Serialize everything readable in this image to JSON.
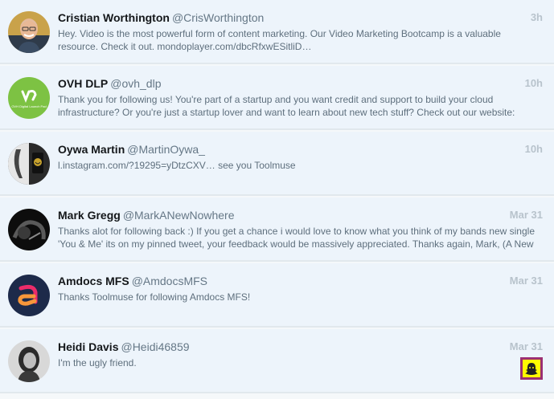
{
  "notifications": [
    {
      "name": "Cristian Worthington",
      "handle": "@CrisWorthington",
      "time": "3h",
      "text": "Hey. Video is the most powerful form of content marketing. Our Video Marketing Bootcamp is a valuable\nresource. Check it out. mondoplayer.com/dbcRfxwESitliD…",
      "avatar_icon": "avatar-man-photo"
    },
    {
      "name": "OVH DLP",
      "handle": "@ovh_dlp",
      "time": "10h",
      "text": "Thank you for following us! You're part of a startup and you want credit and support to build your cloud\ninfrastructure? Or you're just a startup lover and want to learn about new tech stuff? Check out our website:",
      "avatar_icon": "ovh-logo",
      "avatar_caption": "OVH Digital Launch Pad"
    },
    {
      "name": "Oywa Martin",
      "handle": "@MartinOywa_",
      "time": "10h",
      "text": "l.instagram.com/?19295=yDtzCXV… see you Toolmuse",
      "avatar_icon": "avatar-photo"
    },
    {
      "name": "Mark Gregg",
      "handle": "@MarkANewNowhere",
      "time": "Mar 31",
      "text": "Thanks alot for following back :) If you get a chance i would love to know what you think of my bands new single\n'You & Me' its on my pinned tweet, your feedback would be massively appreciated. Thanks again, Mark, (A New",
      "avatar_icon": "avatar-dark-photo"
    },
    {
      "name": "Amdocs MFS",
      "handle": "@AmdocsMFS",
      "time": "Mar 31",
      "text": "Thanks Toolmuse for following Amdocs MFS!",
      "avatar_icon": "amdocs-logo"
    },
    {
      "name": "Heidi Davis",
      "handle": "@Heidi46859",
      "time": "Mar 31",
      "text": "I'm the ugly friend.",
      "avatar_icon": "avatar-woman-photo",
      "media_icon": "snapchat-thumbnail"
    }
  ],
  "colors": {
    "row_background": "#edf4fb",
    "divider": "#e1e8ed",
    "name": "#14171a",
    "handle": "#657786",
    "time": "#b8c3cc",
    "ovh_green": "#7dc243",
    "amdocs_navy": "#1d2a4a",
    "amdocs_pink": "#ec2c6a",
    "snapchat_yellow": "#fffc00"
  }
}
